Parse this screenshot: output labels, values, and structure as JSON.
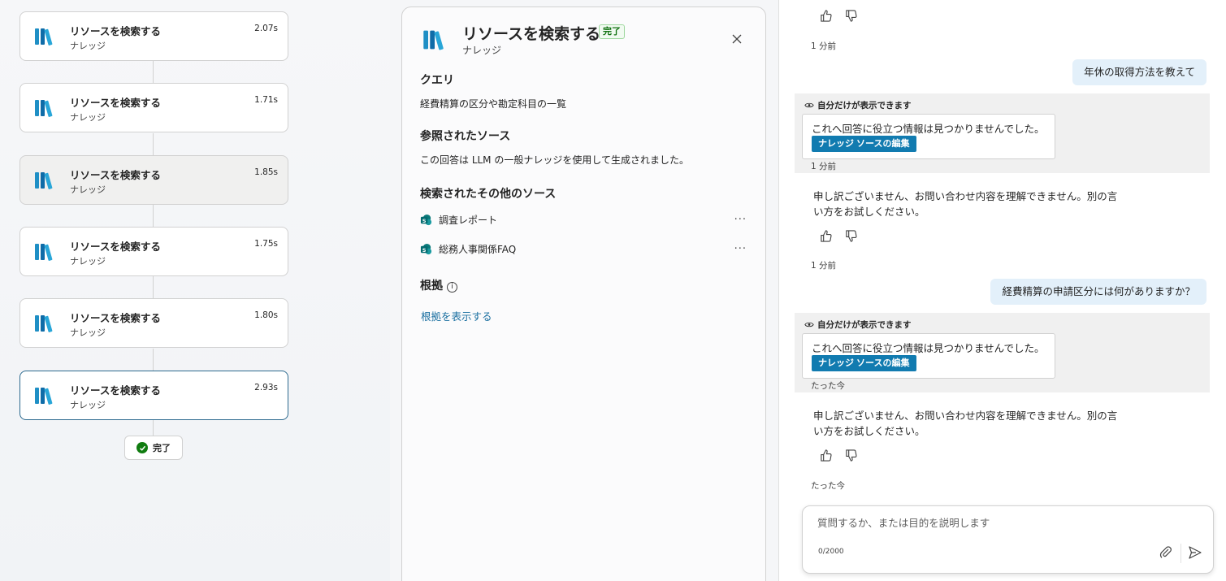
{
  "flow": {
    "steps": [
      {
        "title": "リソースを検索する",
        "sub": "ナレッジ",
        "time": "2.07s"
      },
      {
        "title": "リソースを検索する",
        "sub": "ナレッジ",
        "time": "1.71s"
      },
      {
        "title": "リソースを検索する",
        "sub": "ナレッジ",
        "time": "1.85s"
      },
      {
        "title": "リソースを検索する",
        "sub": "ナレッジ",
        "time": "1.75s"
      },
      {
        "title": "リソースを検索する",
        "sub": "ナレッジ",
        "time": "1.80s"
      },
      {
        "title": "リソースを検索する",
        "sub": "ナレッジ",
        "time": "2.93s"
      }
    ],
    "done_label": "完了"
  },
  "detail": {
    "title": "リソースを検索する",
    "badge": "完了",
    "subtitle": "ナレッジ",
    "query_heading": "クエリ",
    "query_text": "経費精算の区分や勘定科目の一覧",
    "referenced_heading": "参照されたソース",
    "referenced_text": "この回答は LLM の一般ナレッジを使用して生成されました。",
    "other_heading": "検索されたその他のソース",
    "other_sources": [
      "調査レポート",
      "総務人事関係FAQ"
    ],
    "more_label": "···",
    "grounds_heading": "根拠",
    "grounds_link": "根拠を表示する"
  },
  "chat": {
    "ts_top": "1 分前",
    "user_msg_1": "年休の取得方法を教えて",
    "private_label": "自分だけが表示できます",
    "no_info_msg": "これへ回答に役立つ情報は見つかりませんでした。",
    "edit_knowledge_label": "ナレッジ ソースの編集",
    "ts_private_1": "1 分前",
    "bot_reply": "申し訳ございません、お問い合わせ内容を理解できません。別の言い方をお試しください。",
    "ts_after_bot_1": "1 分前",
    "user_msg_2": "経費精算の申請区分には何がありますか？",
    "ts_private_2": "たった今",
    "ts_after_bot_2": "たった今",
    "composer_placeholder": "質問するか、または目的を説明します",
    "char_count": "0/2000"
  },
  "colors": {
    "accent_link": "#1a6fa0",
    "edit_button": "#117bb0",
    "user_bubble": "#e3f0fa",
    "success": "#107c10"
  },
  "icons": [
    "library-icon",
    "close-icon",
    "sharepoint-icon",
    "more-icon",
    "info-icon",
    "thumbs-up-icon",
    "thumbs-down-icon",
    "eye-icon",
    "attach-icon",
    "send-icon",
    "check-icon"
  ]
}
